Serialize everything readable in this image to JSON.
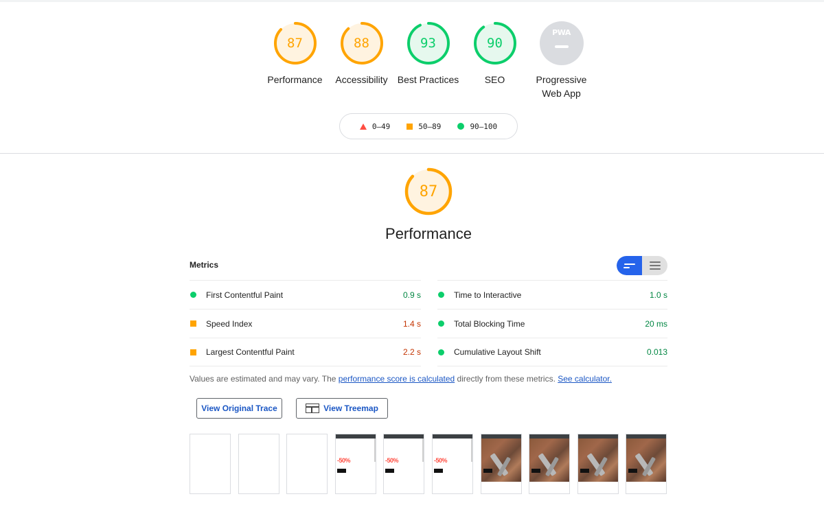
{
  "categories": [
    {
      "label": "Performance",
      "score": "87",
      "fraction": 0.87,
      "color": "#ffa400",
      "fill": "#fff3e0"
    },
    {
      "label": "Accessibility",
      "score": "88",
      "fraction": 0.88,
      "color": "#ffa400",
      "fill": "#fff3e0"
    },
    {
      "label": "Best Practices",
      "score": "93",
      "fraction": 0.93,
      "color": "#0cce6b",
      "fill": "#e6f8ee"
    },
    {
      "label": "SEO",
      "score": "90",
      "fraction": 0.9,
      "color": "#0cce6b",
      "fill": "#e6f8ee"
    }
  ],
  "pwa": {
    "label": "Progressive Web App",
    "badge_text": "PWA"
  },
  "legend": {
    "fail": "0–49",
    "average": "50–89",
    "pass": "90–100"
  },
  "performance": {
    "title": "Performance",
    "score": "87",
    "fraction": 0.87,
    "color": "#ffa400",
    "fill": "#fff3e0"
  },
  "metrics": {
    "header": "Metrics",
    "left": [
      {
        "label": "First Contentful Paint",
        "value": "0.9 s",
        "status": "pass"
      },
      {
        "label": "Speed Index",
        "value": "1.4 s",
        "status": "average"
      },
      {
        "label": "Largest Contentful Paint",
        "value": "2.2 s",
        "status": "average"
      }
    ],
    "right": [
      {
        "label": "Time to Interactive",
        "value": "1.0 s",
        "status": "pass"
      },
      {
        "label": "Total Blocking Time",
        "value": "20 ms",
        "status": "pass"
      },
      {
        "label": "Cumulative Layout Shift",
        "value": "0.013",
        "status": "pass"
      }
    ]
  },
  "note": {
    "prefix": "Values are estimated and may vary. The ",
    "link1": "performance score is calculated",
    "middle": " directly from these metrics. ",
    "link2": "See calculator."
  },
  "buttons": {
    "trace": "View Original Trace",
    "treemap": "View Treemap"
  },
  "filmstrip": {
    "frames": [
      "blank",
      "blank",
      "blank",
      "promo",
      "promo",
      "promo",
      "photo",
      "photo",
      "photo",
      "photo"
    ],
    "promo_pct": "-50%"
  }
}
